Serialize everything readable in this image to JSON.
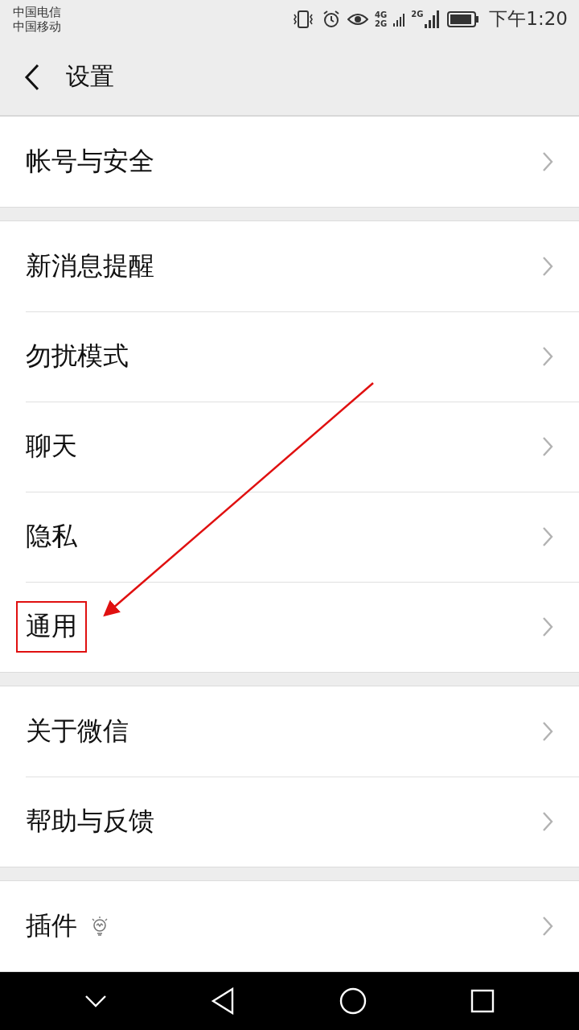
{
  "status_bar": {
    "carriers": [
      "中国电信",
      "中国移动"
    ],
    "network_labels": [
      "4G",
      "2G",
      "2G"
    ],
    "time": "下午1:20"
  },
  "header": {
    "title": "设置"
  },
  "groups": [
    {
      "items": [
        {
          "label": "帐号与安全",
          "highlighted": false,
          "bulb": false
        }
      ]
    },
    {
      "items": [
        {
          "label": "新消息提醒",
          "highlighted": false,
          "bulb": false
        },
        {
          "label": "勿扰模式",
          "highlighted": false,
          "bulb": false
        },
        {
          "label": "聊天",
          "highlighted": false,
          "bulb": false
        },
        {
          "label": "隐私",
          "highlighted": false,
          "bulb": false
        },
        {
          "label": "通用",
          "highlighted": true,
          "bulb": false
        }
      ]
    },
    {
      "items": [
        {
          "label": "关于微信",
          "highlighted": false,
          "bulb": false
        },
        {
          "label": "帮助与反馈",
          "highlighted": false,
          "bulb": false
        }
      ]
    },
    {
      "items": [
        {
          "label": "插件",
          "highlighted": false,
          "bulb": true
        }
      ]
    }
  ]
}
